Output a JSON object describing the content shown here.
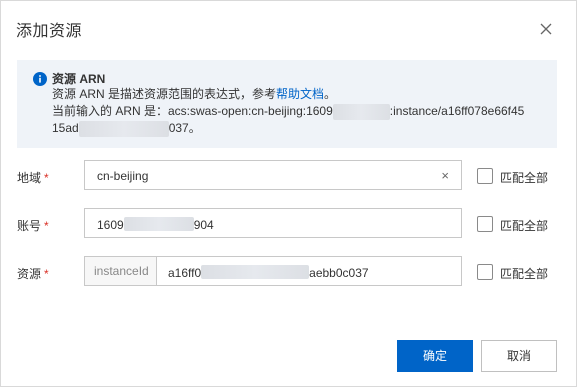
{
  "dialog": {
    "title": "添加资源",
    "close_icon": "close-icon"
  },
  "notice": {
    "icon": "info-icon",
    "title": "资源 ARN",
    "desc_prefix": "资源 ARN 是描述资源范围的表达式，参考",
    "desc_link": "帮助文档",
    "desc_suffix": "。",
    "arn_prefix": "当前输入的 ARN 是：acs:swas-open:cn-beijing:1609",
    "arn_middle": ":instance/a16ff078e66f45",
    "arn_line2_prefix": "15ad",
    "arn_line2_suffix": "037。"
  },
  "form": {
    "region": {
      "label": "地域",
      "required_mark": "*",
      "value": "cn-beijing",
      "clear_icon": "×",
      "match_all": "匹配全部"
    },
    "account": {
      "label": "账号",
      "required_mark": "*",
      "value_prefix": "1609",
      "value_suffix": "904",
      "match_all": "匹配全部"
    },
    "resource": {
      "label": "资源",
      "required_mark": "*",
      "addon": "instanceId",
      "value_prefix": "a16ff0",
      "value_suffix": "aebb0c037",
      "match_all": "匹配全部"
    }
  },
  "footer": {
    "confirm": "确定",
    "cancel": "取消"
  },
  "colors": {
    "primary": "#0064c8",
    "required": "#d93026",
    "notice_bg": "#eff3f8"
  }
}
